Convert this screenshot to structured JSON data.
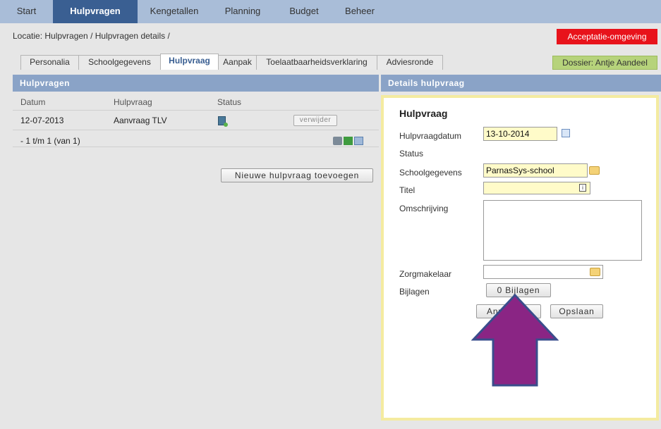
{
  "topnav": {
    "items": [
      {
        "label": "Start",
        "active": false
      },
      {
        "label": "Hulpvragen",
        "active": true
      },
      {
        "label": "Kengetallen",
        "active": false
      },
      {
        "label": "Planning",
        "active": false
      },
      {
        "label": "Budget",
        "active": false
      },
      {
        "label": "Beheer",
        "active": false
      }
    ]
  },
  "breadcrumb": "Locatie: Hulpvragen / Hulpvragen details /",
  "environment_badge": "Acceptatie-omgeving",
  "tabs": [
    {
      "label": "Personalia",
      "active": false
    },
    {
      "label": "Schoolgegevens",
      "active": false
    },
    {
      "label": "Hulpvraag",
      "active": true
    },
    {
      "label": "Aanpak",
      "active": false
    },
    {
      "label": "Toelaatbaarheidsverklaring",
      "active": false
    },
    {
      "label": "Adviesronde",
      "active": false
    }
  ],
  "dossier_badge": "Dossier: Antje Aandeel",
  "left_panel": {
    "title": "Hulpvragen",
    "columns": [
      "Datum",
      "Hulpvraag",
      "Status"
    ],
    "rows": [
      {
        "datum": "12-07-2013",
        "hulpvraag": "Aanvraag TLV",
        "delete_label": "verwijder"
      }
    ],
    "pager": "- 1 t/m 1 (van 1)",
    "add_button": "Nieuwe hulpvraag toevoegen"
  },
  "right_panel": {
    "title": "Details hulpvraag",
    "form_title": "Hulpvraag",
    "labels": {
      "date": "Hulpvraagdatum",
      "status": "Status",
      "school": "Schoolgegevens",
      "title": "Titel",
      "description": "Omschrijving",
      "broker": "Zorgmakelaar",
      "attachments": "Bijlagen"
    },
    "values": {
      "date": "13-10-2014",
      "school": "ParnasSys-school",
      "title": "",
      "description": "",
      "broker": ""
    },
    "attachments_button": "0 Bijlagen",
    "cancel_button": "Annuleren",
    "save_button": "Opslaan"
  },
  "colors": {
    "nav_bg": "#a9bdd8",
    "nav_active": "#3a5f92",
    "panel_head": "#8aa3c7",
    "env_badge": "#e8131b",
    "dossier_badge": "#b6d37b",
    "field_bg": "#fffbc9",
    "arrow_fill": "#8a2584",
    "arrow_stroke": "#3a4d8c"
  }
}
